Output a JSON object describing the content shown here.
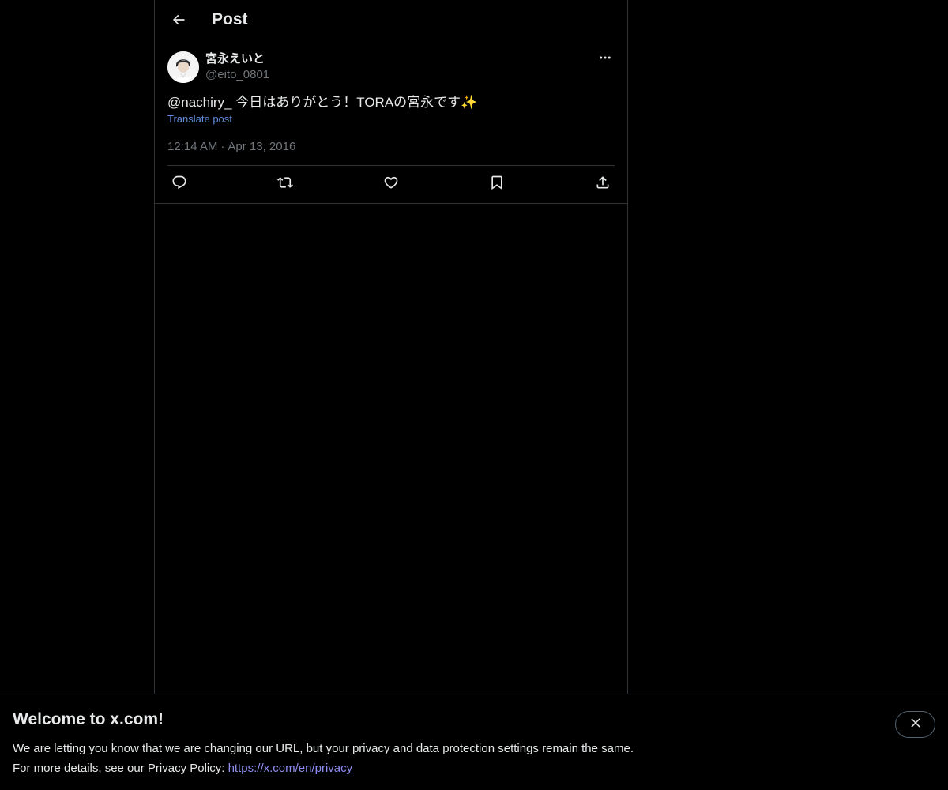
{
  "header": {
    "title": "Post"
  },
  "post": {
    "author": {
      "display_name": "宮永えいと",
      "handle": "@eito_0801"
    },
    "text": {
      "mention": "@nachiry_",
      "body": " 今日はありがとう！TORAの宮永です✨"
    },
    "translate_label": "Translate post",
    "time": "12:14 AM",
    "separator": "·",
    "date": "Apr 13, 2016"
  },
  "icons": {
    "back": "arrow-left-icon",
    "more": "more-horizontal-icon",
    "reply": "reply-icon",
    "repost": "repost-icon",
    "like": "heart-icon",
    "bookmark": "bookmark-icon",
    "share": "share-icon",
    "close": "close-icon"
  },
  "banner": {
    "title": "Welcome to x.com!",
    "line1": "We are letting you know that we are changing our URL, but your privacy and data protection settings remain the same.",
    "line2_prefix": "For more details, see our Privacy Policy: ",
    "link_text": "https://x.com/en/privacy"
  },
  "colors": {
    "background": "#000000",
    "text": "#e7e9ea",
    "muted": "#71767b",
    "link": "#5b8ad8",
    "border": "#2f3336"
  }
}
